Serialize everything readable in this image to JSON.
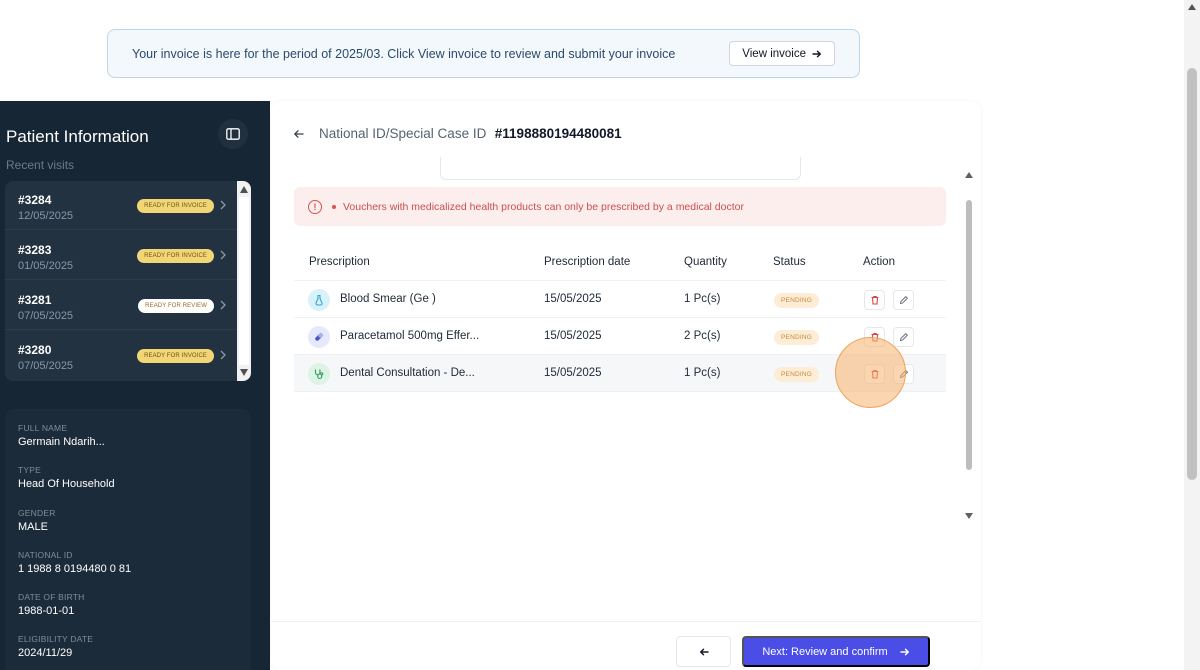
{
  "banner": {
    "text": "Your invoice is here for the period of 2025/03. Click View invoice to review and submit your invoice",
    "button_label": "View invoice",
    "button_icon": "arrow-right-icon"
  },
  "sidebar": {
    "title": "Patient Information",
    "subtitle": "Recent visits",
    "visits": [
      {
        "id": "#3284",
        "date": "12/05/2025",
        "badge": "READY FOR INVOICE"
      },
      {
        "id": "#3283",
        "date": "01/05/2025",
        "badge": "READY FOR INVOICE"
      },
      {
        "id": "#3281",
        "date": "07/05/2025",
        "badge": "READY FOR REVIEW"
      },
      {
        "id": "#3280",
        "date": "07/05/2025",
        "badge": "READY FOR INVOICE"
      }
    ],
    "info": [
      {
        "label": "FULL NAME",
        "value": "Germain Ndarih..."
      },
      {
        "label": "TYPE",
        "value": "Head Of Household"
      },
      {
        "label": "GENDER",
        "value": "MALE"
      },
      {
        "label": "NATIONAL ID",
        "value": "1 1988 8 0194480 0 81"
      },
      {
        "label": "DATE OF BIRTH",
        "value": "1988-01-01"
      },
      {
        "label": "ELIGIBILITY DATE",
        "value": "2024/11/29"
      }
    ]
  },
  "main": {
    "head_label": "National ID/Special Case ID",
    "head_id": "#1198880194480081",
    "alert_text": "Vouchers with medicalized health products can only be prescribed by a medical doctor",
    "columns": [
      "Prescription",
      "Prescription date",
      "Quantity",
      "Status",
      "Action"
    ],
    "rows": [
      {
        "name": "Blood Smear (Ge )",
        "date": "15/05/2025",
        "qty": "1 Pc(s)",
        "status": "PENDING",
        "icon": "test-tube-icon",
        "icon_bg": "#d9f1fb",
        "icon_color": "#2aa7d6"
      },
      {
        "name": "Paracetamol 500mg Effer...",
        "date": "15/05/2025",
        "qty": "2 Pc(s)",
        "status": "PENDING",
        "icon": "pill-icon",
        "icon_bg": "#e6e9fb",
        "icon_color": "#4a56c9"
      },
      {
        "name": "Dental Consultation - De...",
        "date": "15/05/2025",
        "qty": "1 Pc(s)",
        "status": "PENDING",
        "icon": "stethoscope-icon",
        "icon_bg": "#ddf3e5",
        "icon_color": "#2f9e5c"
      }
    ]
  },
  "footer": {
    "back_icon": "arrow-left-icon",
    "next_label": "Next: Review and confirm",
    "next_icon": "arrow-right-icon"
  },
  "colors": {
    "sidebar_bg": "#172634",
    "primary": "#4a4de6",
    "alert_text": "#cc4f4a",
    "delete_icon": "#d9453f",
    "ready_badge": "#f2d675"
  }
}
